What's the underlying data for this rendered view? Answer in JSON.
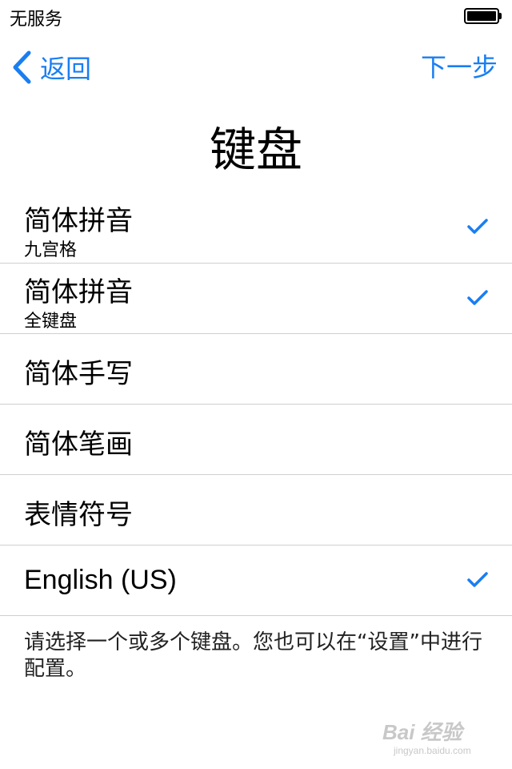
{
  "status_bar": {
    "carrier": "无服务"
  },
  "nav": {
    "back_label": "返回",
    "next_label": "下一步"
  },
  "title": "键盘",
  "keyboards": [
    {
      "label": "简体拼音",
      "sublabel": "九宫格",
      "checked": true
    },
    {
      "label": "简体拼音",
      "sublabel": "全键盘",
      "checked": true
    },
    {
      "label": "简体手写",
      "checked": false
    },
    {
      "label": "简体笔画",
      "checked": false
    },
    {
      "label": "表情符号",
      "checked": false
    },
    {
      "label": "English (US)",
      "checked": true
    }
  ],
  "footnote": "请选择一个或多个键盘。您也可以在“设置”中进行配置。",
  "watermark": {
    "logo": "Bai 经验",
    "url": "jingyan.baidu.com"
  },
  "colors": {
    "accent": "#1a7ef2",
    "separator": "#cfcfd3"
  }
}
